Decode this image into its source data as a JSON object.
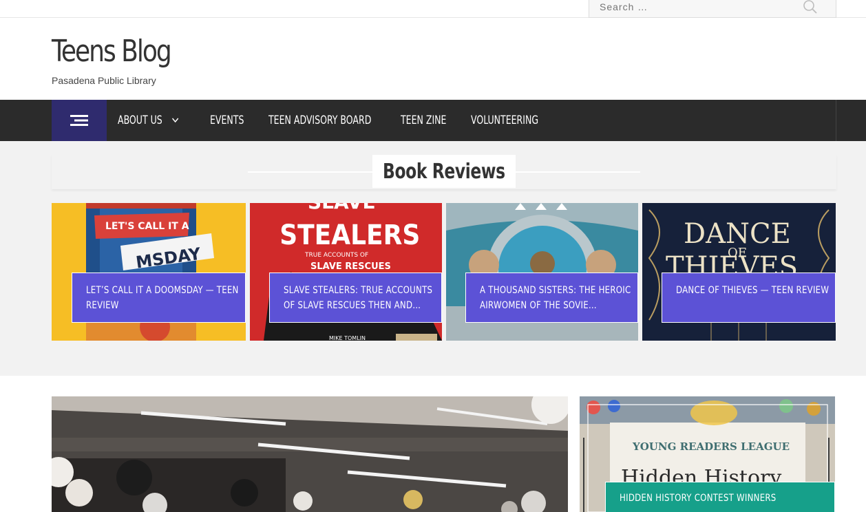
{
  "search": {
    "placeholder": "Search …"
  },
  "site": {
    "title": "Teens Blog",
    "description": "Pasadena Public Library"
  },
  "nav": {
    "items": [
      {
        "label": "About Us",
        "has_dropdown": true
      },
      {
        "label": "Events"
      },
      {
        "label": "Teen Advisory Board"
      },
      {
        "label": "Teen Zine"
      },
      {
        "label": "Volunteering"
      }
    ]
  },
  "reviews": {
    "heading": "Book Reviews",
    "cards": [
      {
        "title": "Let’s Call It a Doomsday — Teen Review",
        "cover_text": [
          "LET'S CALL IT A",
          "MSDAY"
        ]
      },
      {
        "title": "Slave Stealers: True Accounts of Slave Rescues Then and…",
        "cover_text": [
          "SLAVE",
          "STEALERS",
          "TRUE ACCOUNTS OF",
          "SLAVE RESCUES",
          "MIKE TOMLIN"
        ]
      },
      {
        "title": "A Thousand Sisters: The Heroic Airwomen of the Sovie…",
        "cover_text": []
      },
      {
        "title": "Dance of Thieves — Teen Review",
        "cover_text": [
          "DANCE",
          "OF",
          "THIEVES"
        ]
      }
    ]
  },
  "featured": {
    "side": {
      "title": "Hidden History Contest Winners",
      "cover_text": [
        "YOUNG READERS LEAGUE",
        "Hidden History"
      ]
    }
  },
  "colors": {
    "accent": "#5c52d6",
    "nav_bg": "#2b2b2b",
    "toggle_bg": "#2f2b6e",
    "teal": "#16a08a"
  }
}
